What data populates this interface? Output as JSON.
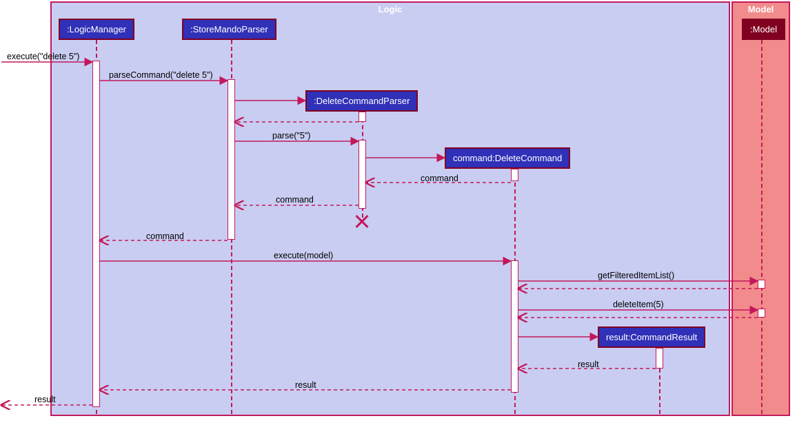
{
  "diagram_type": "sequence",
  "regions": {
    "logic": {
      "title": "Logic"
    },
    "model": {
      "title": "Model"
    }
  },
  "participants": {
    "logicManager": ":LogicManager",
    "storeMandoParser": ":StoreMandoParser",
    "deleteCommandParser": ":DeleteCommandParser",
    "deleteCommand": "command:DeleteCommand",
    "commandResult": "result:CommandResult",
    "model": ":Model"
  },
  "messages": {
    "execute_delete5": "execute(\"delete 5\")",
    "parseCommand": "parseCommand(\"delete 5\")",
    "parse5": "parse(\"5\")",
    "command1": "command",
    "command2": "command",
    "command3": "command",
    "executeModel": "execute(model)",
    "getFilteredItemList": "getFilteredItemList()",
    "deleteItem5": "deleteItem(5)",
    "result1": "result",
    "result2": "result",
    "result3": "result"
  }
}
